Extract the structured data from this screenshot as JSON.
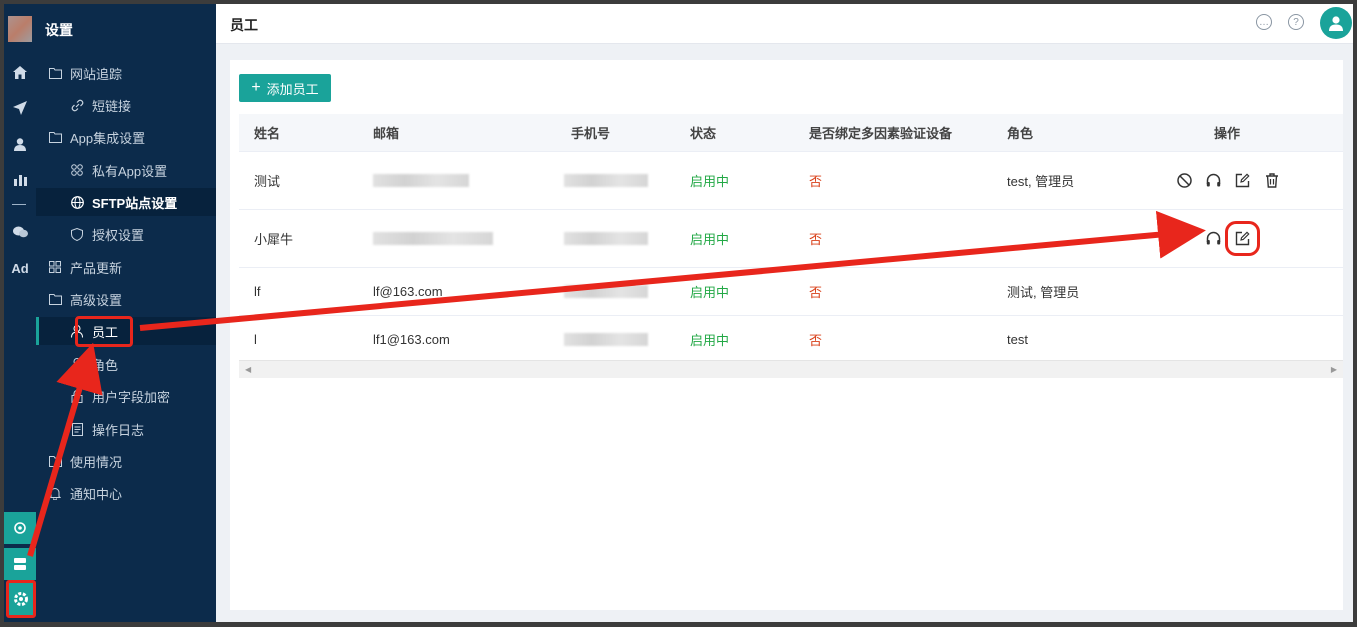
{
  "app": {
    "section_title": "设置"
  },
  "menu": {
    "items": [
      {
        "label": "网站追踪",
        "icon": "folder-icon"
      },
      {
        "label": "短链接",
        "icon": "link-icon"
      },
      {
        "label": "App集成设置",
        "icon": "folder-icon"
      },
      {
        "label": "私有App设置",
        "icon": "grid-icon"
      },
      {
        "label": "SFTP站点设置",
        "icon": "globe-icon"
      },
      {
        "label": "授权设置",
        "icon": "shield-icon"
      },
      {
        "label": "产品更新",
        "icon": "grid-icon"
      },
      {
        "label": "高级设置",
        "icon": "folder-icon"
      },
      {
        "label": "员工",
        "icon": "user-icon"
      },
      {
        "label": "角色",
        "icon": "user-icon"
      },
      {
        "label": "用户字段加密",
        "icon": "lock-icon"
      },
      {
        "label": "操作日志",
        "icon": "document-icon"
      },
      {
        "label": "使用情况",
        "icon": "folder-icon"
      },
      {
        "label": "通知中心",
        "icon": "bell-icon"
      }
    ]
  },
  "rail": {
    "icons": [
      "home-icon",
      "send-icon",
      "user-icon",
      "bar-chart-icon",
      "wechat-icon"
    ],
    "ad_label": "Ad"
  },
  "header": {
    "page_title": "员工"
  },
  "toolbar": {
    "add_label": "添加员工"
  },
  "table": {
    "columns": [
      "姓名",
      "邮箱",
      "手机号",
      "状态",
      "是否绑定多因素验证设备",
      "角色",
      "操作"
    ],
    "rows": [
      {
        "name": "测试",
        "email": "",
        "phone": "",
        "status": "启用中",
        "mfa": "否",
        "roles": "test, 管理员"
      },
      {
        "name": "小犀牛",
        "email": "",
        "phone": "",
        "status": "启用中",
        "mfa": "否",
        "roles": ""
      },
      {
        "name": "lf",
        "email": "lf@163.com",
        "phone": "",
        "status": "启用中",
        "mfa": "否",
        "roles": "测试, 管理员"
      },
      {
        "name": "l",
        "email": "lf1@163.com",
        "phone": "",
        "status": "启用中",
        "mfa": "否",
        "roles": "test"
      }
    ]
  },
  "colors": {
    "accent": "#1aa39a",
    "sidebar": "#0c2b4b",
    "status_green": "#22a845",
    "status_red": "#d9401a",
    "annotation_red": "#e8261c"
  }
}
